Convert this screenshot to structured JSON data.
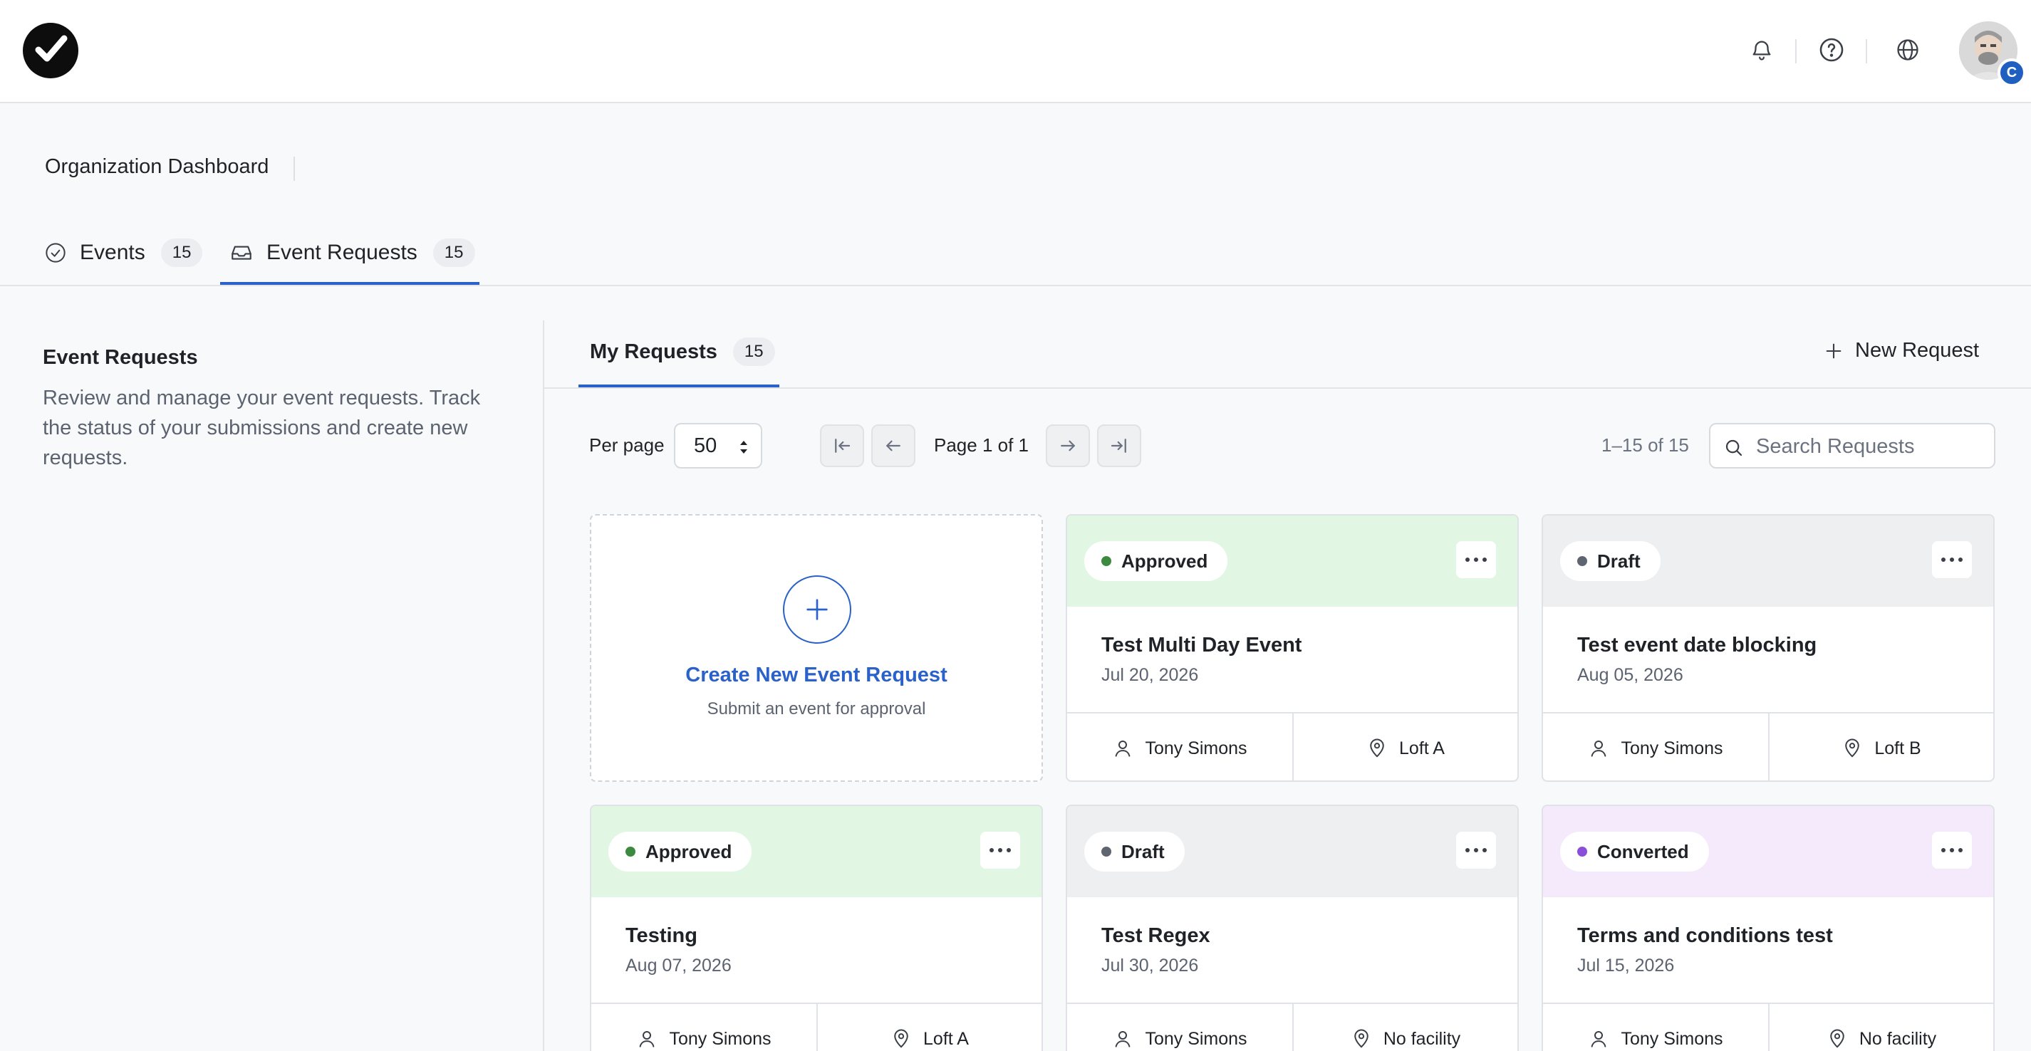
{
  "header": {
    "notifications_icon": "bell-icon",
    "help_icon": "help-circle-icon",
    "language_icon": "globe-icon",
    "avatar_badge": "C"
  },
  "page": {
    "title": "Organization Dashboard",
    "tabs": [
      {
        "label": "Events",
        "count": "15"
      },
      {
        "label": "Event Requests",
        "count": "15"
      }
    ]
  },
  "sidebar": {
    "title": "Event Requests",
    "description": "Review and manage your event requests. Track the status of your submissions and create new requests."
  },
  "requests": {
    "tab_label": "My Requests",
    "tab_count": "15",
    "new_request_label": "New Request",
    "per_page_label": "Per page",
    "per_page_value": "50",
    "page_label": "Page 1 of 1",
    "range_label": "1–15 of 15",
    "search_placeholder": "Search Requests",
    "create_card": {
      "title": "Create New Event Request",
      "subtitle": "Submit an event for approval"
    },
    "cards": [
      {
        "status": "Approved",
        "title": "Test Multi Day Event",
        "date": "Jul 20, 2026",
        "person": "Tony Simons",
        "location": "Loft A"
      },
      {
        "status": "Draft",
        "title": "Test event date blocking",
        "date": "Aug 05, 2026",
        "person": "Tony Simons",
        "location": "Loft B"
      },
      {
        "status": "Approved",
        "title": "Testing",
        "date": "Aug 07, 2026",
        "person": "Tony Simons",
        "location": "Loft A"
      },
      {
        "status": "Draft",
        "title": "Test Regex",
        "date": "Jul 30, 2026",
        "person": "Tony Simons",
        "location": "No facility"
      },
      {
        "status": "Converted",
        "title": "Terms and conditions test",
        "date": "Jul 15, 2026",
        "person": "Tony Simons",
        "location": "No facility"
      }
    ]
  },
  "colors": {
    "accent": "#2a62c9",
    "approved_bg": "#e2f7e3",
    "approved_dot": "#3c8a3f",
    "draft_bg": "#eeeff1",
    "draft_dot": "#5f6570",
    "converted_bg": "#f4eafb",
    "converted_dot": "#8a4fd8"
  }
}
